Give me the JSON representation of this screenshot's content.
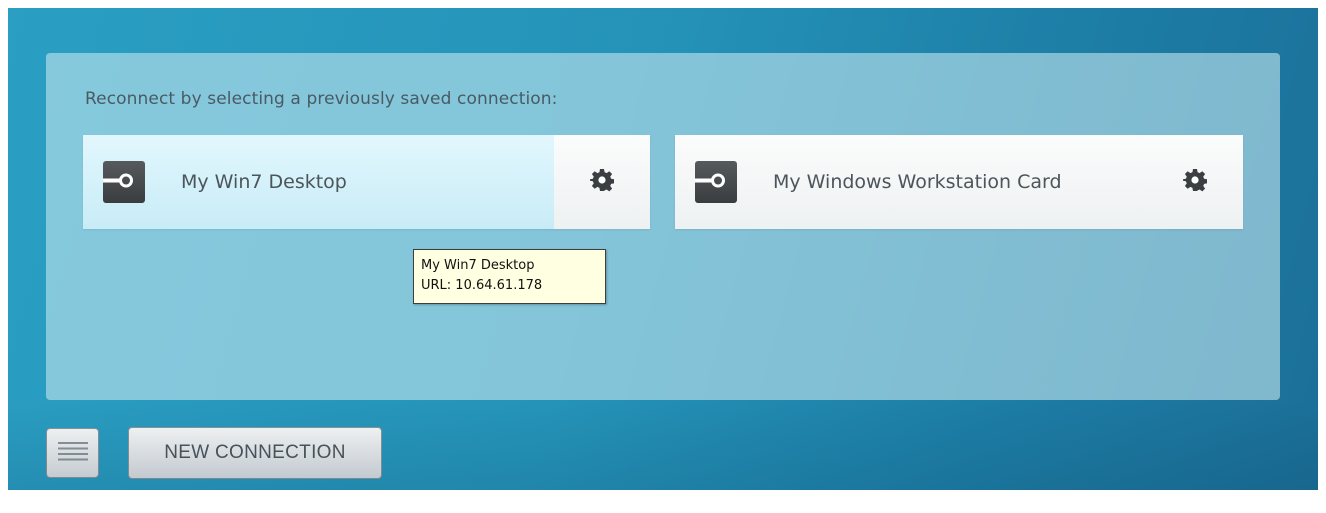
{
  "panel": {
    "prompt": "Reconnect by selecting a previously saved connection:"
  },
  "connections": [
    {
      "label": "My Win7 Desktop",
      "icon": "connection-plug-icon",
      "settings_icon": "gear-icon",
      "selected": true
    },
    {
      "label": "My Windows Workstation Card",
      "icon": "connection-plug-icon",
      "settings_icon": "gear-icon",
      "selected": false
    }
  ],
  "tooltip": {
    "title": "My Win7 Desktop",
    "url": "URL: 10.64.61.178"
  },
  "footer": {
    "menu_icon": "hamburger-menu-icon",
    "new_connection_label": "NEW CONNECTION"
  },
  "colors": {
    "background": "#2593b8",
    "panel": "#bee4ee",
    "selected_card": "#d4f1fa",
    "tooltip_bg": "#ffffe1"
  }
}
